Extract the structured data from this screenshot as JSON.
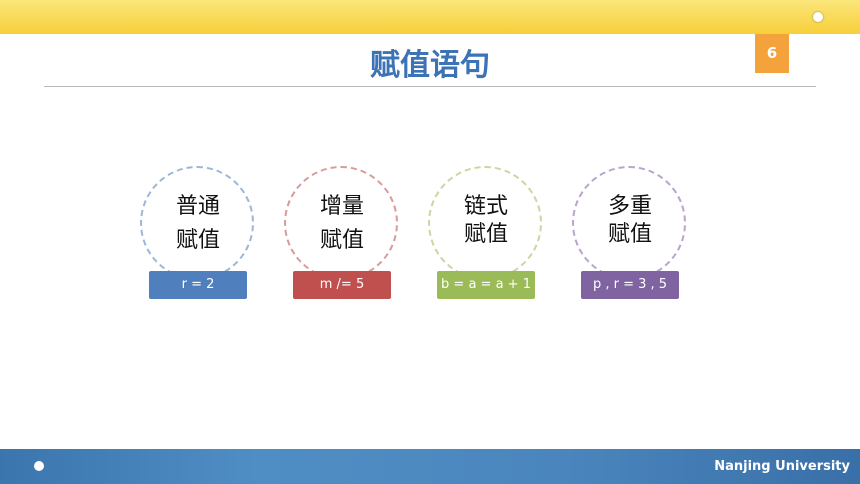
{
  "slide": {
    "title": "赋值语句",
    "page_number": "6",
    "footer": "Nanjing University"
  },
  "concepts": [
    {
      "line1": "普通",
      "line2": "赋值",
      "example": "r = 2",
      "ring_color": "#9bb6d8",
      "tag_color": "#4f80bd"
    },
    {
      "line1": "增量",
      "line2": "赋值",
      "example": "m /= 5",
      "ring_color": "#d79b9b",
      "tag_color": "#c0504d"
    },
    {
      "line1": "链式",
      "line2": "赋值",
      "example": "b = a = a + 1",
      "ring_color": "#cdd5a0",
      "tag_color": "#9bbb59"
    },
    {
      "line1": "多重",
      "line2": "赋值",
      "example": "p , r = 3 , 5",
      "ring_color": "#b8a4cc",
      "tag_color": "#8064a2"
    }
  ]
}
